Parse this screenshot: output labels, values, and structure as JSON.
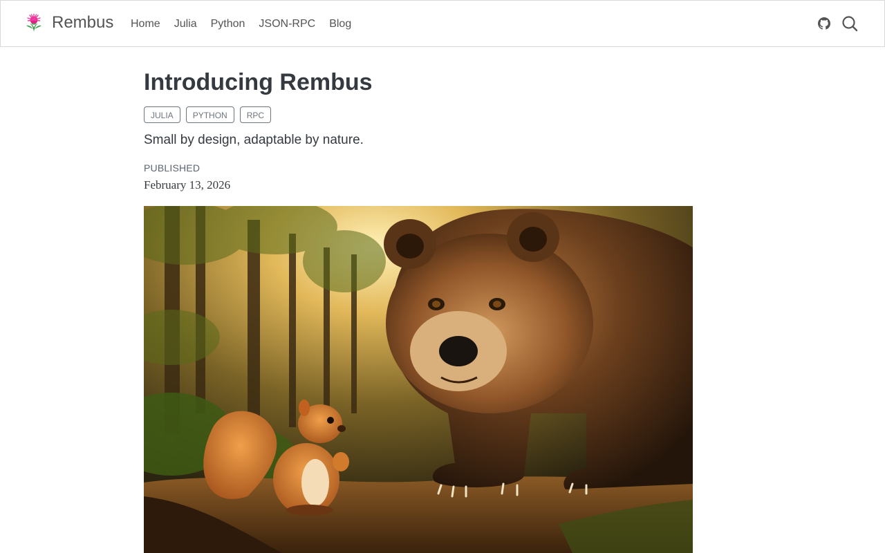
{
  "site": {
    "name": "Rembus"
  },
  "nav": {
    "links": [
      "Home",
      "Julia",
      "Python",
      "JSON-RPC",
      "Blog"
    ]
  },
  "icons": {
    "logo": "thistle-flower-logo",
    "github": "github-icon",
    "search": "search-icon"
  },
  "post": {
    "title": "Introducing Rembus",
    "tags": [
      "JULIA",
      "PYTHON",
      "RPC"
    ],
    "subtitle": "Small by design, adaptable by nature.",
    "published_label": "PUBLISHED",
    "published_date": "February 13, 2026"
  },
  "colors": {
    "text": "#343a40",
    "nav_text": "#545454",
    "tag_border": "#6c757d",
    "logo_pink": "#e0218a",
    "logo_green": "#2e8b3e"
  }
}
